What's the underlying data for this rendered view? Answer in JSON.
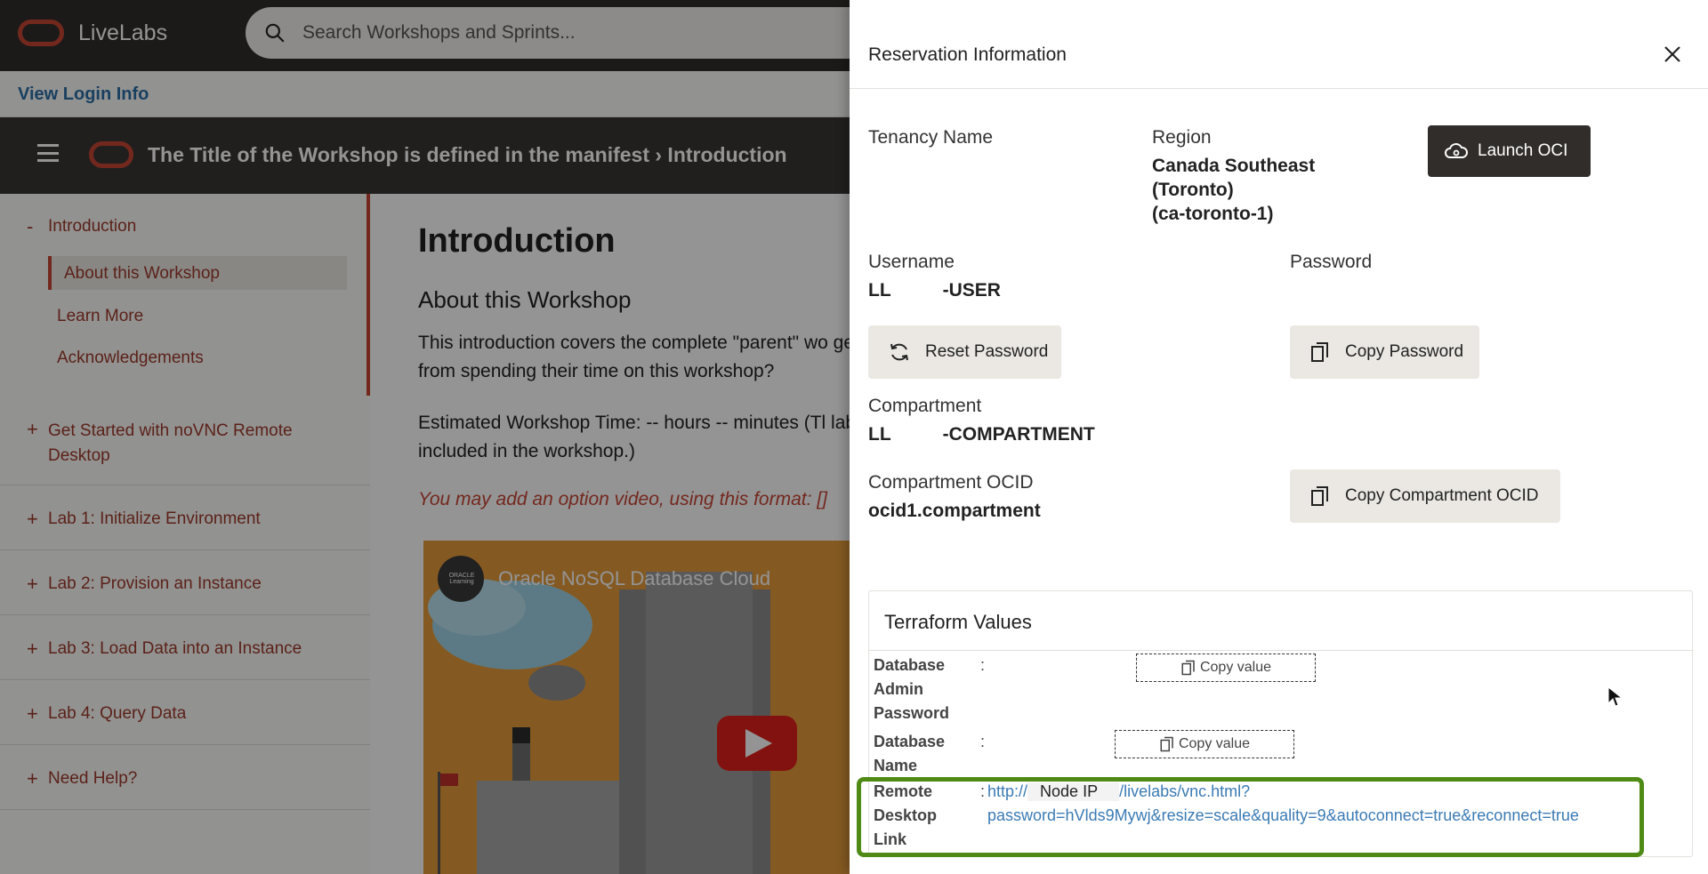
{
  "header": {
    "brand": "LiveLabs",
    "search_placeholder": "Search Workshops and Sprints..."
  },
  "login_link": "View Login Info",
  "breadcrumb": "The Title of the Workshop is defined in the manifest  › Introduction",
  "nav": {
    "intro": "Introduction",
    "sub_items": [
      "About this Workshop",
      "Learn More",
      "Acknowledgements"
    ],
    "labs": [
      "Get Started with noVNC Remote Desktop",
      "Lab 1: Initialize Environment",
      "Lab 2: Provision an Instance",
      "Lab 3: Load Data into an Instance",
      "Lab 4: Query Data",
      "Need Help?"
    ]
  },
  "content": {
    "h1": "Introduction",
    "h2": "About this Workshop",
    "para1": "This introduction covers the complete \"parent\" wo get from spending their time on this workshop?",
    "para2": "Estimated Workshop Time: -- hours -- minutes (Tl labs included in the workshop.)",
    "para3": "You may add an option video, using this format: []",
    "video_title": "Oracle NoSQL Database Cloud",
    "video_channel": "ORACLE Learning"
  },
  "drawer": {
    "title": "Reservation Information",
    "tenancy_label": "Tenancy Name",
    "region_label": "Region",
    "region_value": [
      "Canada Southeast",
      "(Toronto)",
      "(ca-toronto-1)"
    ],
    "launch_button": "Launch OCI",
    "username_label": "Username",
    "username_value": "LL          -USER",
    "password_label": "Password",
    "reset_button": "Reset Password",
    "copy_password_button": "Copy Password",
    "compartment_label": "Compartment",
    "compartment_value": "LL          -COMPARTMENT",
    "ocid_label": "Compartment OCID",
    "ocid_value": "ocid1.compartment",
    "copy_ocid_button": "Copy Compartment OCID",
    "terraform": {
      "title": "Terraform Values",
      "rows": [
        {
          "key": [
            "Database",
            "Admin",
            "Password"
          ],
          "button": "Copy value"
        },
        {
          "key": [
            "Database",
            "Name"
          ],
          "button": "Copy value"
        },
        {
          "key": [
            "Remote",
            "Desktop",
            "Link"
          ]
        }
      ],
      "link_prefix": "http://",
      "link_node": "Node IP",
      "link_path": "/livelabs/vnc.html?",
      "link_query": "password=hVlds9Mywj&resize=scale&quality=9&autoconnect=true&reconnect=true"
    }
  }
}
